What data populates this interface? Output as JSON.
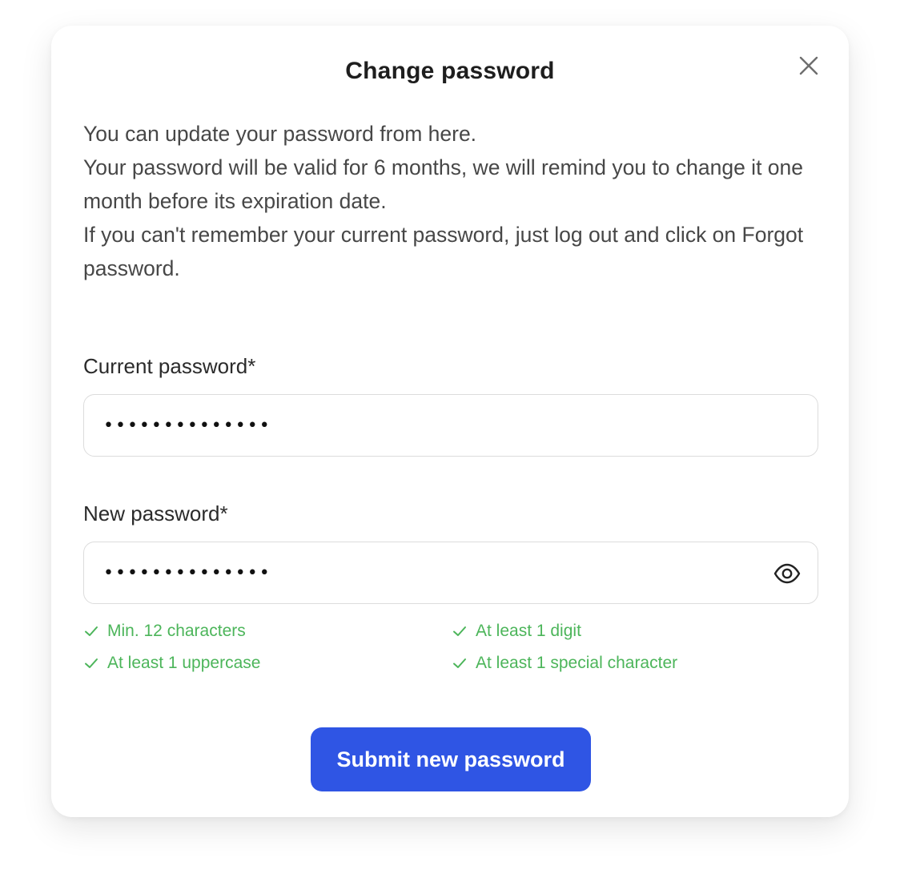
{
  "modal": {
    "title": "Change password",
    "close_icon": "close-icon",
    "description": [
      "You can update your password from here.",
      "Your password will be valid for 6 months, we will remind you to change it one month before its expiration date.",
      "If you can't remember your current password, just log out and click on Forgot password."
    ]
  },
  "form": {
    "current_password": {
      "label": "Current password*",
      "value": "••••••••••••••"
    },
    "new_password": {
      "label": "New password*",
      "value": "••••••••••••••",
      "toggle_icon": "eye-icon"
    },
    "rules": [
      {
        "text": "Min. 12 characters",
        "met": true,
        "icon": "check-icon"
      },
      {
        "text": "At least 1 digit",
        "met": true,
        "icon": "check-icon"
      },
      {
        "text": "At least 1 uppercase",
        "met": true,
        "icon": "check-icon"
      },
      {
        "text": "At least 1 special character",
        "met": true,
        "icon": "check-icon"
      }
    ],
    "submit_label": "Submit new password"
  },
  "colors": {
    "primary": "#2f55e4",
    "success": "#4cb55a",
    "title_text": "#1e1e1e",
    "body_text": "#474747",
    "input_border": "#dcdcdc"
  }
}
